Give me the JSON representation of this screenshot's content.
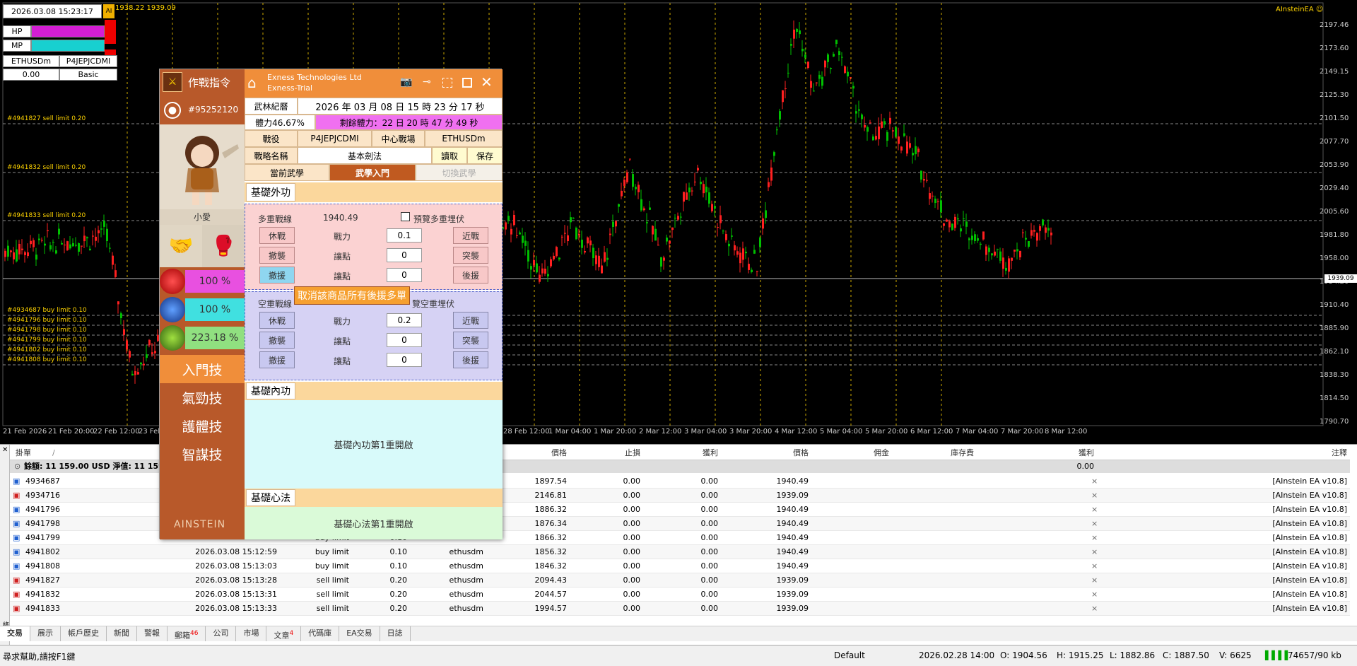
{
  "chart": {
    "top_left_time": "2026.03.08 15:23:17",
    "top_left_tag": "AI",
    "quote": "1938.22 1939.09",
    "ea_label": "AInsteinEA ☺",
    "hp_label": "HP",
    "mp_label": "MP",
    "symbol": "ETHUSDm",
    "account_code": "P4JEPJCDMI",
    "value": "0.00",
    "mode": "Basic",
    "order_lines": [
      "#4941827 sell limit 0.20",
      "#4941832 sell limit 0.20",
      "#4941833 sell limit 0.20",
      "#4934687 buy limit 0.10",
      "#4941796 buy limit 0.10",
      "#4941798 buy limit 0.10",
      "#4941799 buy limit 0.10",
      "#4941802 buy limit 0.10",
      "#4941808 buy limit 0.10"
    ],
    "price_ticks": [
      "2197.46",
      "2173.60",
      "2149.15",
      "2125.30",
      "2101.50",
      "2077.70",
      "2053.90",
      "2029.40",
      "2005.60",
      "1981.80",
      "1958.00",
      "1934.20",
      "1910.40",
      "1885.90",
      "1862.10",
      "1838.30",
      "1814.50",
      "1790.70"
    ],
    "current_price": "1939.09",
    "time_ticks": [
      "21 Feb 2026",
      "21 Feb 20:00",
      "22 Feb 12:00",
      "23 Feb",
      "28 Feb 12:00",
      "1 Mar 04:00",
      "1 Mar 20:00",
      "2 Mar 12:00",
      "3 Mar 04:00",
      "3 Mar 20:00",
      "4 Mar 12:00",
      "5 Mar 04:00",
      "5 Mar 20:00",
      "6 Mar 12:00",
      "7 Mar 04:00",
      "7 Mar 20:00",
      "8 Mar 12:00"
    ]
  },
  "ea": {
    "side": {
      "header": "作戰指令",
      "account": "#95252120",
      "char_name": "小愛",
      "hp_pct": "100 %",
      "mp_pct": "100 %",
      "sp_pct": "223.18 %",
      "menu": [
        "入門技",
        "氣勁技",
        "護體技",
        "智謀技"
      ],
      "logo": "AINSTEIN"
    },
    "title_line1": "Exness Technologies Ltd",
    "title_line2": "Exness-Trial",
    "calendar_label": "武林紀曆",
    "calendar_value": "2026 年 03 月 08 日 15 時 23 分 17 秒",
    "stamina": "體力46.67%",
    "remaining": "剩餘體力：22 日 20 時 47 分 49 秒",
    "battle_label": "戰役",
    "battle_value": "P4JEPJCDMI",
    "arena_label": "中心戰場",
    "arena_value": "ETHUSDm",
    "strategy_label": "戰略名稱",
    "strategy_value": "基本劍法",
    "read_btn": "讀取",
    "save_btn": "保存",
    "tab_current": "當前武學",
    "tab_intro": "武學入門",
    "tab_switch": "切換武學",
    "sect_outer": "基礎外功",
    "long_line_label": "多重戰線",
    "long_line_value": "1940.49",
    "preview_long": "預覽多重埋伏",
    "short_line_label": "空重戰線",
    "preview_short": "覽空重埋伏",
    "tooltip": "取消該商品所有後援多單",
    "btn_rest": "休戰",
    "btn_withdraw": "撤襲",
    "btn_retreat": "撤援",
    "btn_near": "近戰",
    "btn_raid": "突襲",
    "btn_backup": "後援",
    "lbl_power": "戰力",
    "lbl_concede": "讓點",
    "long_inputs": [
      "0.1",
      "0",
      "0"
    ],
    "short_inputs": [
      "0.2",
      "0",
      "0"
    ],
    "sect_inner": "基礎內功",
    "inner_text": "基礎內功第1重開啟",
    "sect_mind": "基礎心法",
    "mind_text": "基礎心法第1重開啟"
  },
  "terminal": {
    "headers": {
      "order": "掛單",
      "price": "價格",
      "sl": "止損",
      "tp": "獲利",
      "price2": "價格",
      "commission": "佣金",
      "swap": "庫存費",
      "profit": "獲利",
      "comment": "注釋"
    },
    "summary": "餘額: 11 159.00 USD  淨值: 11 159",
    "summary_total": "0.00",
    "rows": [
      {
        "id": "4934687",
        "time": "",
        "type": "",
        "vol": "",
        "sym": "",
        "price": "1897.54",
        "sl": "0.00",
        "tp": "0.00",
        "cur": "1940.49",
        "comment": "[AInstein EA v10.8]",
        "kind": "buy"
      },
      {
        "id": "4934716",
        "time": "",
        "type": "",
        "vol": "",
        "sym": "",
        "price": "2146.81",
        "sl": "0.00",
        "tp": "0.00",
        "cur": "1939.09",
        "comment": "[AInstein EA v10.8]",
        "kind": "sell"
      },
      {
        "id": "4941796",
        "time": "",
        "type": "",
        "vol": "",
        "sym": "",
        "price": "1886.32",
        "sl": "0.00",
        "tp": "0.00",
        "cur": "1940.49",
        "comment": "[AInstein EA v10.8]",
        "kind": "buy"
      },
      {
        "id": "4941798",
        "time": "",
        "type": "",
        "vol": "",
        "sym": "",
        "price": "1876.34",
        "sl": "0.00",
        "tp": "0.00",
        "cur": "1940.49",
        "comment": "[AInstein EA v10.8]",
        "kind": "buy"
      },
      {
        "id": "4941799",
        "time": "",
        "type": "buy limit",
        "vol": "0.10",
        "sym": "",
        "price": "1866.32",
        "sl": "0.00",
        "tp": "0.00",
        "cur": "1940.49",
        "comment": "[AInstein EA v10.8]",
        "kind": "buy"
      },
      {
        "id": "4941802",
        "time": "2026.03.08 15:12:59",
        "type": "buy limit",
        "vol": "0.10",
        "sym": "ethusdm",
        "price": "1856.32",
        "sl": "0.00",
        "tp": "0.00",
        "cur": "1940.49",
        "comment": "[AInstein EA v10.8]",
        "kind": "buy"
      },
      {
        "id": "4941808",
        "time": "2026.03.08 15:13:03",
        "type": "buy limit",
        "vol": "0.10",
        "sym": "ethusdm",
        "price": "1846.32",
        "sl": "0.00",
        "tp": "0.00",
        "cur": "1940.49",
        "comment": "[AInstein EA v10.8]",
        "kind": "buy"
      },
      {
        "id": "4941827",
        "time": "2026.03.08 15:13:28",
        "type": "sell limit",
        "vol": "0.20",
        "sym": "ethusdm",
        "price": "2094.43",
        "sl": "0.00",
        "tp": "0.00",
        "cur": "1939.09",
        "comment": "[AInstein EA v10.8]",
        "kind": "sell"
      },
      {
        "id": "4941832",
        "time": "2026.03.08 15:13:31",
        "type": "sell limit",
        "vol": "0.20",
        "sym": "ethusdm",
        "price": "2044.57",
        "sl": "0.00",
        "tp": "0.00",
        "cur": "1939.09",
        "comment": "[AInstein EA v10.8]",
        "kind": "sell"
      },
      {
        "id": "4941833",
        "time": "2026.03.08 15:13:33",
        "type": "sell limit",
        "vol": "0.20",
        "sym": "ethusdm",
        "price": "1994.57",
        "sl": "0.00",
        "tp": "0.00",
        "cur": "1939.09",
        "comment": "[AInstein EA v10.8]",
        "kind": "sell"
      }
    ],
    "tabs": [
      "交易",
      "展示",
      "帳戶歷史",
      "新聞",
      "警報",
      "郵箱",
      "公司",
      "市場",
      "文章",
      "代碼庫",
      "EA交易",
      "日誌"
    ],
    "tab_badges": {
      "郵箱": "46",
      "文章": "4"
    },
    "side_label": "終端"
  },
  "status": {
    "help": "尋求幫助,請按F1鍵",
    "profile": "Default",
    "datetime": "2026.02.28 14:00",
    "open": "O: 1904.56",
    "high": "H: 1915.25",
    "low": "L: 1882.86",
    "close": "C: 1887.50",
    "volume": "V: 6625",
    "traffic": "74657/90 kb"
  },
  "colors": {
    "accent": "#f08e3a",
    "side": "#b8592a",
    "up": "#00c000",
    "down": "#ff2020",
    "order_line": "#ffd400"
  }
}
